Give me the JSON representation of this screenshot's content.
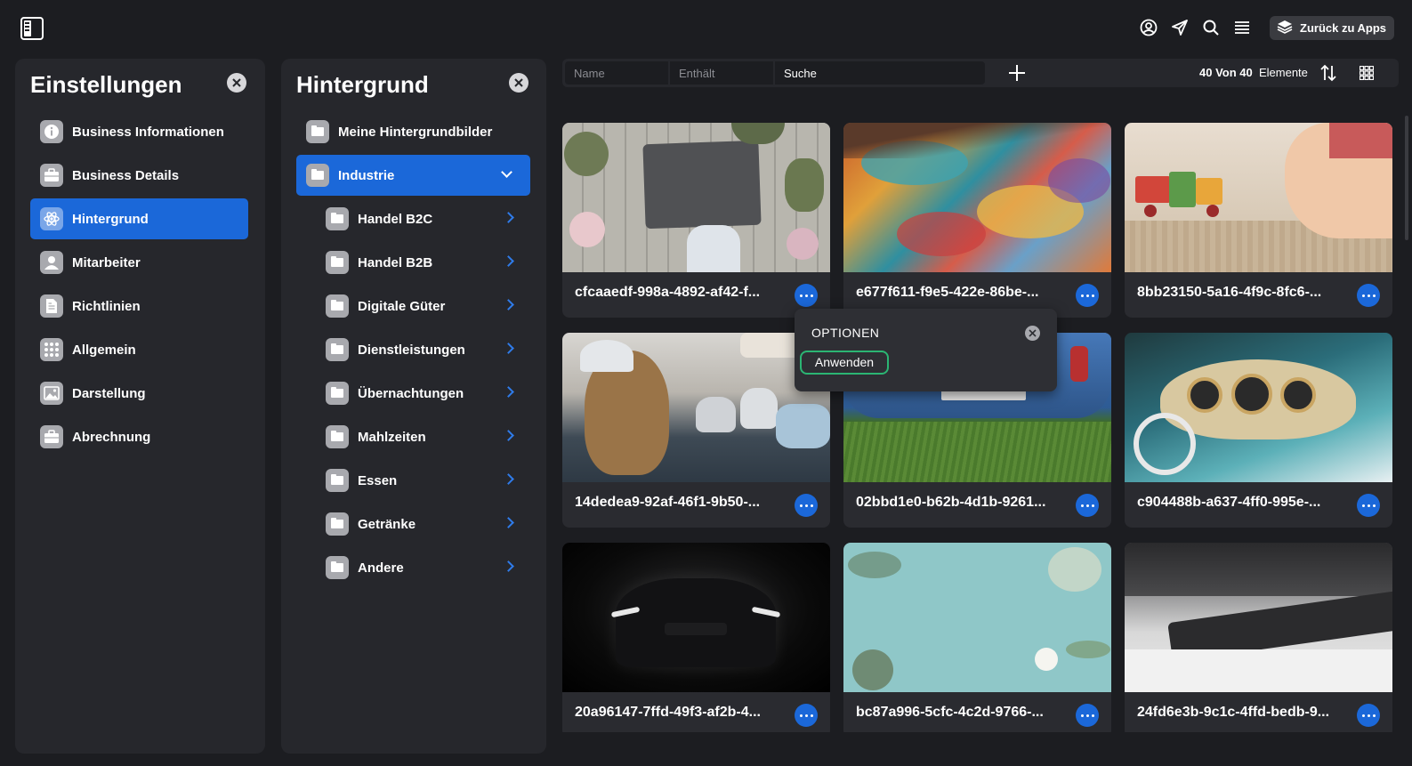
{
  "topbar": {
    "back_label": "Zurück zu Apps",
    "icons": [
      "user-circle-icon",
      "send-icon",
      "search-icon",
      "menu-icon"
    ]
  },
  "settings": {
    "title": "Einstellungen",
    "items": [
      {
        "label": "Business Informationen",
        "icon": "info-icon",
        "active": false
      },
      {
        "label": "Business Details",
        "icon": "briefcase-icon",
        "active": false
      },
      {
        "label": "Hintergrund",
        "icon": "atom-icon",
        "active": true
      },
      {
        "label": "Mitarbeiter",
        "icon": "person-icon",
        "active": false
      },
      {
        "label": "Richtlinien",
        "icon": "document-icon",
        "active": false
      },
      {
        "label": "Allgemein",
        "icon": "grid-dots-icon",
        "active": false
      },
      {
        "label": "Darstellung",
        "icon": "image-icon",
        "active": false
      },
      {
        "label": "Abrechnung",
        "icon": "briefcase-icon",
        "active": false
      }
    ]
  },
  "background": {
    "title": "Hintergrund",
    "my_backgrounds": "Meine Hintergrundbilder",
    "industry": "Industrie",
    "subitems": [
      "Handel B2C",
      "Handel B2B",
      "Digitale Güter",
      "Dienstleistungen",
      "Übernachtungen",
      "Mahlzeiten",
      "Essen",
      "Getränke",
      "Andere"
    ]
  },
  "filter": {
    "name_placeholder": "Name",
    "contains_placeholder": "Enthält",
    "search_placeholder": "Suche",
    "count_bold": "40 Von 40",
    "count_suffix": "Elemente"
  },
  "images": [
    {
      "title": "cfcaaedf-998a-4892-af42-f...",
      "theme": "flowers-paper"
    },
    {
      "title": "e677f611-f9e5-422e-86be-...",
      "theme": "paint-palette"
    },
    {
      "title": "8bb23150-5a16-4f9c-8fc6-...",
      "theme": "toy-train"
    },
    {
      "title": "14dedea9-92af-46f1-9b50-...",
      "theme": "teddy-bear"
    },
    {
      "title": "02bbd1e0-b62b-4d1b-9261...",
      "theme": "classic-car-rear"
    },
    {
      "title": "c904488b-a637-4ff0-995e-...",
      "theme": "car-dashboard"
    },
    {
      "title": "20a96147-7ffd-49f3-af2b-4...",
      "theme": "black-car"
    },
    {
      "title": "bc87a996-5cfc-4c2d-9766-...",
      "theme": "flatlay-teal"
    },
    {
      "title": "24fd6e3b-9c1c-4ffd-bedb-9...",
      "theme": "soundbar"
    }
  ],
  "popover": {
    "title": "OPTIONEN",
    "apply_label": "Anwenden"
  },
  "colors": {
    "accent": "#1b68d9",
    "apply_border": "#2bb573",
    "panel": "#26272c",
    "background": "#1c1d21"
  }
}
